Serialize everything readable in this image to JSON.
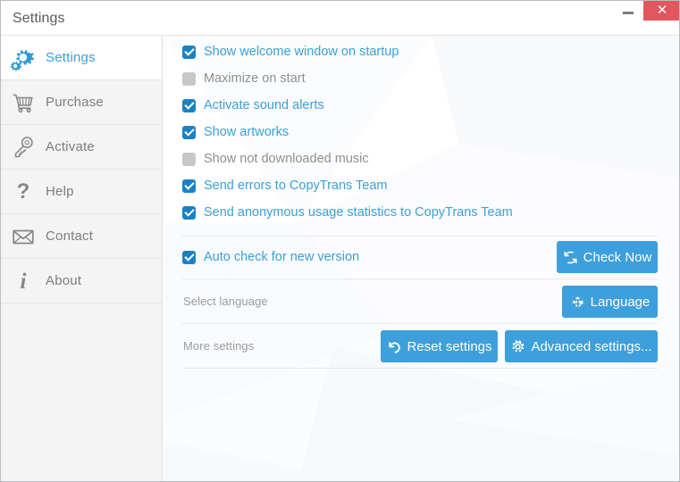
{
  "window": {
    "title": "Settings",
    "minimize_label": "Minimize",
    "close_label": "✕",
    "close_color": "#e2575f",
    "accent_color": "#3d9fdb",
    "link_color": "#3aa0d8"
  },
  "sidebar": {
    "items": [
      {
        "label": "Settings",
        "icon": "gears-icon",
        "active": true
      },
      {
        "label": "Purchase",
        "icon": "shopping-cart-icon",
        "active": false
      },
      {
        "label": "Activate",
        "icon": "key-icon",
        "active": false
      },
      {
        "label": "Help",
        "icon": "question-mark-icon",
        "active": false
      },
      {
        "label": "Contact",
        "icon": "envelope-icon",
        "active": false
      },
      {
        "label": "About",
        "icon": "info-icon",
        "active": false
      }
    ]
  },
  "main": {
    "checkboxes": [
      {
        "label": "Show welcome window on startup",
        "checked": true
      },
      {
        "label": "Maximize on start",
        "checked": false
      },
      {
        "label": "Activate sound alerts",
        "checked": true
      },
      {
        "label": "Show artworks",
        "checked": true
      },
      {
        "label": "Show not downloaded music",
        "checked": false
      },
      {
        "label": "Send errors to CopyTrans Team",
        "checked": true
      },
      {
        "label": "Send anonymous usage statistics to CopyTrans Team",
        "checked": true
      }
    ],
    "update_row": {
      "checkbox_label": "Auto check for new version",
      "checked": true,
      "button_label": "Check Now",
      "button_icon": "refresh-icon"
    },
    "language_row": {
      "label": "Select language",
      "button_label": "Language",
      "button_icon": "globe-icon"
    },
    "more_row": {
      "label": "More settings",
      "reset_button_label": "Reset settings",
      "reset_button_icon": "undo-arrow-icon",
      "advanced_button_label": "Advanced settings...",
      "advanced_button_icon": "gear-icon"
    }
  }
}
